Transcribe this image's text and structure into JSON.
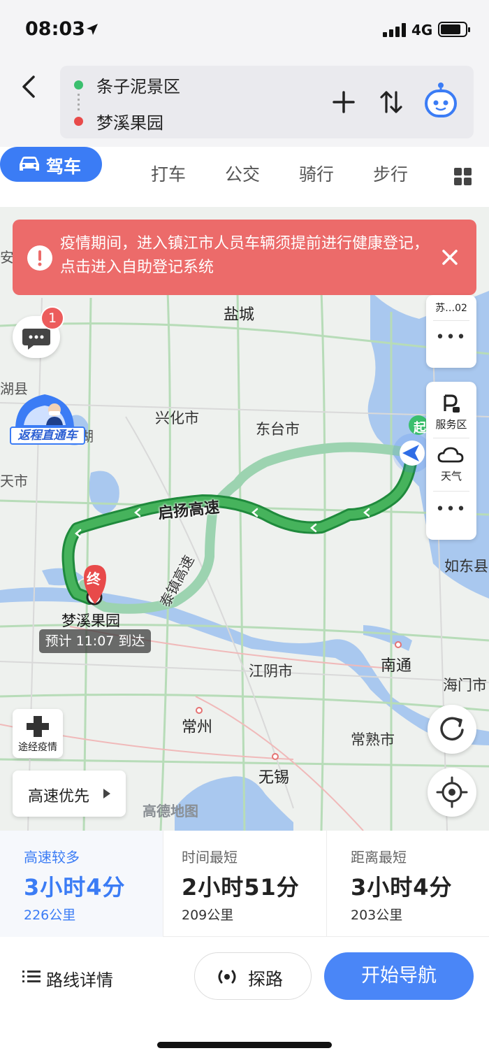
{
  "status": {
    "time": "08:03",
    "network": "4G"
  },
  "header": {
    "origin": "条子泥景区",
    "destination": "梦溪果园"
  },
  "tabs": {
    "drive": "驾车",
    "taxi": "打车",
    "bus": "公交",
    "ride": "骑行",
    "walk": "步行"
  },
  "notice": {
    "text": "疫情期间，进入镇江市人员车辆须提前进行健康登记，点击进入自助登记系统"
  },
  "map": {
    "message_badge_count": "1",
    "return_badge": "返程直通车",
    "side_top_label": "苏…02",
    "service_area": "服务区",
    "weather": "天气",
    "start_marker": "起",
    "end_marker": "终",
    "end_label": "梦溪果园",
    "eta": "预计 11:07 到达",
    "epidemic_btn": "途经疫情",
    "highway_pref": "高速优先",
    "watermark": "高德地图",
    "road_qiyang": "启扬高速",
    "road_taizhen": "泰镇高速",
    "cities": {
      "yancheng": "盐城",
      "xinghua": "兴化市",
      "dongtai": "东台市",
      "rudong": "如东县",
      "jiangyin": "江阴市",
      "nantong": "南通",
      "haimen": "海门市",
      "changzhou": "常州",
      "changshu": "常熟市",
      "wuxi": "无锡",
      "edge_an": "安",
      "edge_hu": "湖县",
      "edge_shi": "天市",
      "edge_hu2": "湖"
    }
  },
  "routes": [
    {
      "tag": "高速较多",
      "time": "3小时4分",
      "distance": "226公里"
    },
    {
      "tag": "时间最短",
      "time": "2小时51分",
      "distance": "209公里"
    },
    {
      "tag": "距离最短",
      "time": "3小时4分",
      "distance": "203公里"
    }
  ],
  "actions": {
    "details": "路线详情",
    "explore": "探路",
    "start_nav": "开始导航"
  },
  "colors": {
    "accent": "#3b7cf5",
    "route_main": "#3aa856",
    "route_alt": "#9cd3b0",
    "notice_bg": "#ec6b6a"
  }
}
